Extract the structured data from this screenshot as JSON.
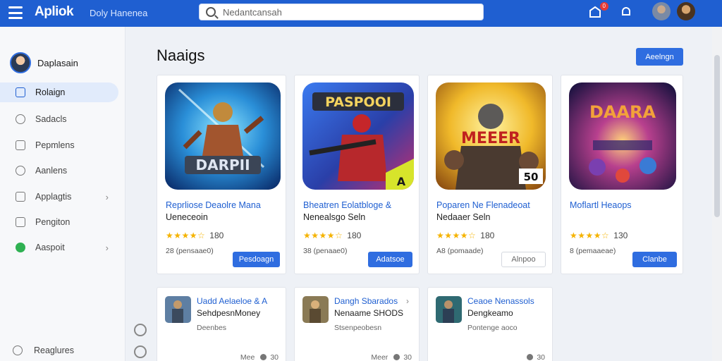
{
  "topbar": {
    "brand": "Apliok",
    "breadcrumb": "Doly Hanenea",
    "search_placeholder": "Nedantcansah",
    "notification_count": "0"
  },
  "sidebar": {
    "user_name": "Daplasain",
    "items": [
      {
        "label": "Rolaign",
        "icon": "home-icon",
        "active": true
      },
      {
        "label": "Sadacls",
        "icon": "link-icon"
      },
      {
        "label": "Pepmlens",
        "icon": "chat-icon"
      },
      {
        "label": "Aanlens",
        "icon": "clock-icon"
      },
      {
        "label": "Applagtis",
        "icon": "doc-icon",
        "chevron": true
      },
      {
        "label": "Pengiton",
        "icon": "file-icon"
      },
      {
        "label": "Aaspoit",
        "icon": "android-icon",
        "chevron": true
      }
    ],
    "footer_label": "Reaglures"
  },
  "main": {
    "title": "Naaigs",
    "action_label": "Aeelngn",
    "cards": [
      {
        "title": "Reprliose Deaolre Mana",
        "subtitle": "Ueneceoin",
        "stars": "★★★★☆",
        "count": "180",
        "meta": "28 (pensaae0)",
        "button": "Pesdoagn",
        "ghost": false
      },
      {
        "title": "Bheatren Eolatbloge &",
        "subtitle": "Nenealsgo Seln",
        "stars": "★★★★☆",
        "count": "180",
        "meta": "38 (penaae0)",
        "button": "Adatsoe",
        "ghost": false
      },
      {
        "title": "Poparen Ne Flenadeoat",
        "subtitle": "Nedaaer Seln",
        "stars": "★★★★☆",
        "count": "180",
        "meta": "A8 (pomaade)",
        "button": "Alnpoo",
        "ghost": true
      },
      {
        "title": "Moflartl Heaops",
        "subtitle": "",
        "stars": "★★★★☆",
        "count": "130",
        "meta": "8 (pemaaeae)",
        "button": "Clanbe",
        "ghost": false
      }
    ],
    "mini_cards": [
      {
        "title": "Uadd Aelaeloe  &  A",
        "subtitle": "SehdpesnMoney",
        "meta": "Deenbes",
        "foot_label": "Mee",
        "foot_count": "30"
      },
      {
        "title": "Dangh Sbarados",
        "subtitle": "Nenaame SHODS",
        "meta": "Stsenpeobesn",
        "foot_label": "Meer",
        "foot_count": "30"
      },
      {
        "title": "Ceaoe Nenassols",
        "subtitle": "Dengkeamo",
        "meta": "Pontenge aoco",
        "foot_label": "",
        "foot_count": "30"
      }
    ],
    "card_art_text": [
      "DARPII",
      "PASPOOI",
      "MEEER",
      "DAARA"
    ],
    "card_art_badges": [
      "",
      "A",
      "50",
      ""
    ]
  }
}
